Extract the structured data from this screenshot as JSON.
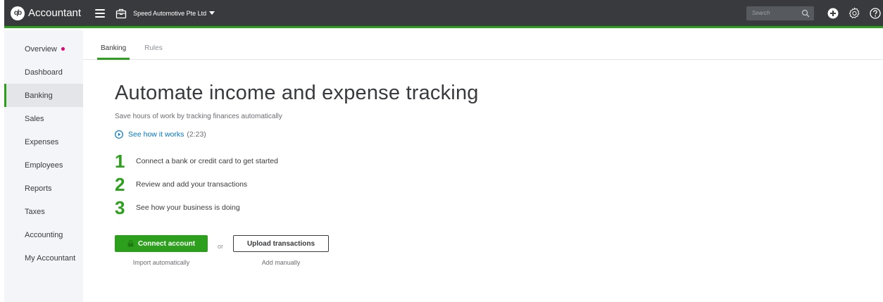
{
  "topbar": {
    "logo_text": "qb",
    "brand": "Accountant",
    "company": "Speed Automotive Pte Ltd",
    "search_placeholder": "Search",
    "accent_color": "#2ca01c",
    "bar_color": "#393a3d"
  },
  "sidebar": {
    "items": [
      {
        "label": "Overview"
      },
      {
        "label": "Dashboard"
      },
      {
        "label": "Banking"
      },
      {
        "label": "Sales"
      },
      {
        "label": "Expenses"
      },
      {
        "label": "Employees"
      },
      {
        "label": "Reports"
      },
      {
        "label": "Taxes"
      },
      {
        "label": "Accounting"
      },
      {
        "label": "My Accountant"
      }
    ],
    "active": "Banking",
    "notification_dot_color": "#e20074"
  },
  "tabs": [
    {
      "label": "Banking"
    },
    {
      "label": "Rules"
    }
  ],
  "main": {
    "headline": "Automate income and expense tracking",
    "subheading": "Save hours of work by tracking finances automatically",
    "video_link": "See how it works",
    "video_duration": "(2:23)",
    "steps": [
      {
        "number": "1",
        "text": "Connect a bank or credit card to get started"
      },
      {
        "number": "2",
        "text": "Review and add your transactions"
      },
      {
        "number": "3",
        "text": "See how your business is doing"
      }
    ],
    "connect_button": "Connect account",
    "connect_caption": "Import automatically",
    "or_text": "or",
    "upload_button": "Upload transactions",
    "upload_caption": "Add manually",
    "link_color": "#0077c5"
  }
}
